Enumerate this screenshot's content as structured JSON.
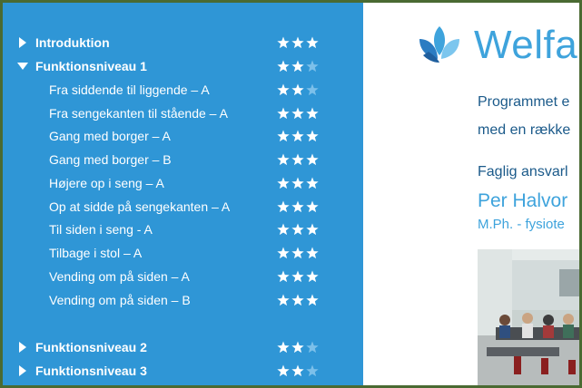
{
  "sidebar": {
    "sections": [
      {
        "label": "Introduktion",
        "expanded": false,
        "rating": 3
      },
      {
        "label": "Funktionsniveau 1",
        "expanded": true,
        "rating": 2
      },
      {
        "label": "Funktionsniveau 2",
        "expanded": false,
        "rating": 2
      },
      {
        "label": "Funktionsniveau 3",
        "expanded": false,
        "rating": 2
      }
    ],
    "lessons": [
      {
        "label": "Fra siddende til liggende – A",
        "rating": 2
      },
      {
        "label": "Fra sengekanten til stående – A",
        "rating": 3
      },
      {
        "label": "Gang med borger – A",
        "rating": 3
      },
      {
        "label": "Gang med borger – B",
        "rating": 3
      },
      {
        "label": "Højere op i seng – A",
        "rating": 3
      },
      {
        "label": "Op at sidde på sengekanten – A",
        "rating": 3
      },
      {
        "label": "Til siden i seng - A",
        "rating": 3
      },
      {
        "label": "Tilbage i stol – A",
        "rating": 3
      },
      {
        "label": "Vending om på siden – A",
        "rating": 3
      },
      {
        "label": "Vending om på siden – B",
        "rating": 3
      }
    ]
  },
  "main": {
    "brand": "Welfa",
    "intro_line1": "Programmet e",
    "intro_line2": "med en række",
    "responsible_label": "Faglig ansvarl",
    "person_name": "Per Halvor",
    "person_title": "M.Ph. - fysiote"
  },
  "colors": {
    "sidebar_bg": "#2f96d6",
    "star_on": "#ffffff",
    "star_off": "#7cc0ea",
    "brand": "#3ea3dc",
    "text_dark": "#1b5a8a",
    "frame": "#4a6a32"
  },
  "icons": {
    "collapsed": "triangle-right-icon",
    "expanded": "triangle-down-icon",
    "rating": "star-icon",
    "logo": "lotus-logo-icon"
  }
}
